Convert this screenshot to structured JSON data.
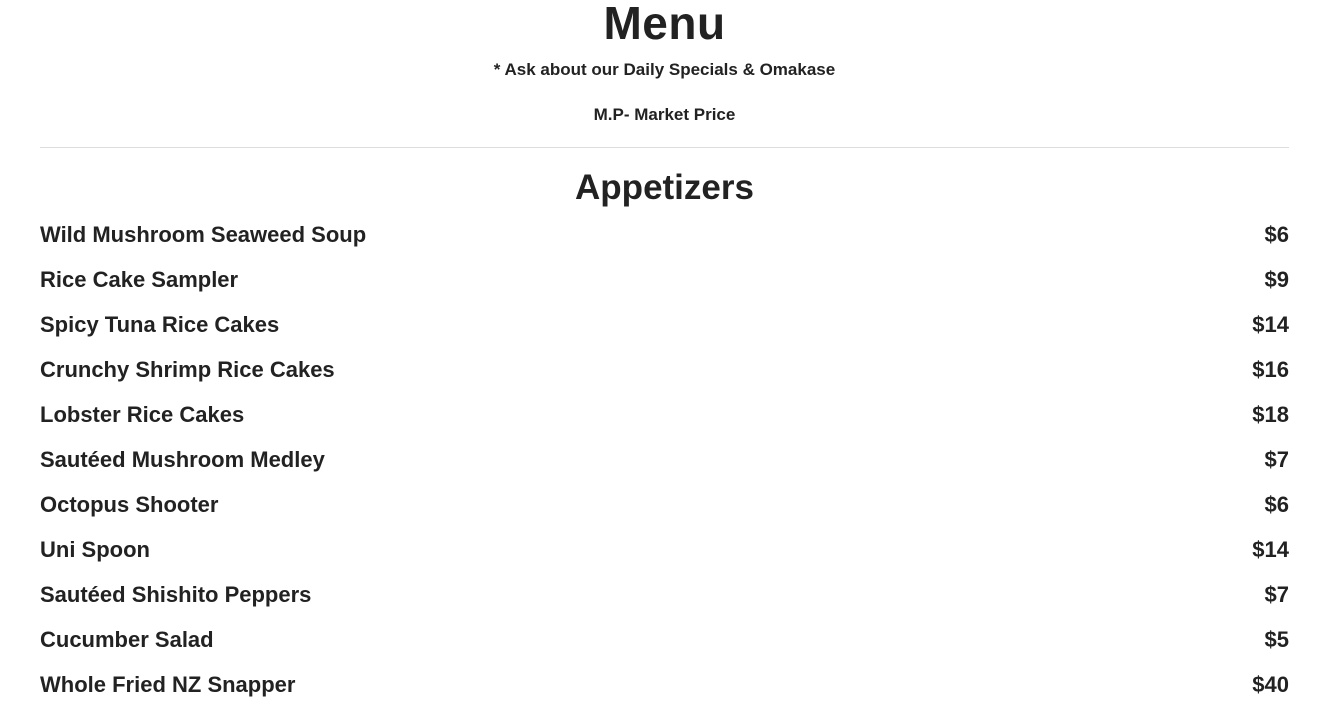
{
  "menu": {
    "title": "Menu",
    "notes": [
      "* Ask about our Daily Specials & Omakase",
      "M.P- Market Price"
    ]
  },
  "section": {
    "title": "Appetizers",
    "items": [
      {
        "name": "Wild Mushroom Seaweed Soup",
        "price": "$6"
      },
      {
        "name": "Rice Cake Sampler",
        "price": "$9"
      },
      {
        "name": "Spicy Tuna Rice Cakes",
        "price": "$14"
      },
      {
        "name": "Crunchy Shrimp Rice Cakes",
        "price": "$16"
      },
      {
        "name": "Lobster Rice Cakes",
        "price": "$18"
      },
      {
        "name": "Sautéed Mushroom Medley",
        "price": "$7"
      },
      {
        "name": "Octopus Shooter",
        "price": "$6"
      },
      {
        "name": "Uni Spoon",
        "price": "$14"
      },
      {
        "name": "Sautéed Shishito Peppers",
        "price": "$7"
      },
      {
        "name": "Cucumber Salad",
        "price": "$5"
      },
      {
        "name": "Whole Fried NZ Snapper",
        "price": "$40"
      }
    ]
  }
}
